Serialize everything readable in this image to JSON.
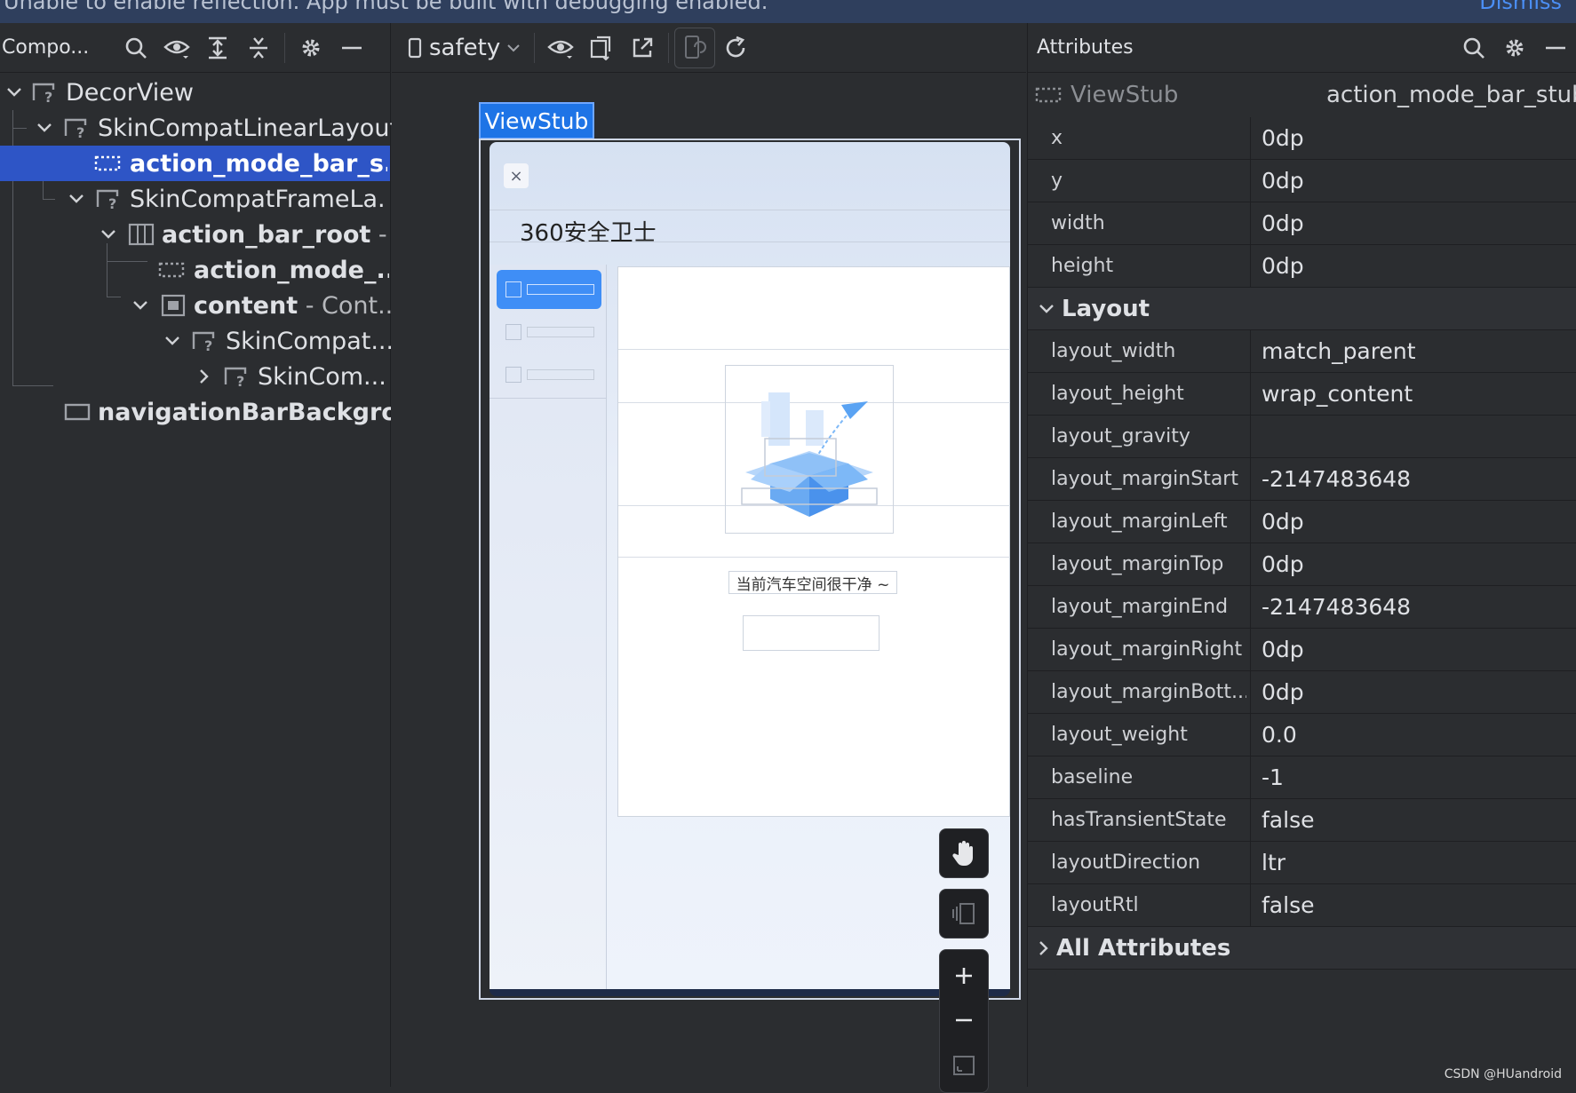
{
  "notice": {
    "message": "Unable to enable reflection. App must be built with debugging enabled.",
    "dismiss": "Dismiss"
  },
  "component_tree": {
    "title": "Compo...",
    "nodes": [
      {
        "label": "DecorView",
        "suffix": ""
      },
      {
        "label": "SkinCompatLinearLayout",
        "suffix": ""
      },
      {
        "label": "action_mode_bar_s...",
        "suffix": ""
      },
      {
        "label": "SkinCompatFrameLa...",
        "suffix": ""
      },
      {
        "label": "action_bar_root",
        "suffix": " -..."
      },
      {
        "label": "action_mode_...",
        "suffix": ""
      },
      {
        "label": "content",
        "suffix": " - Cont..."
      },
      {
        "label": "SkinCompat...",
        "suffix": ""
      },
      {
        "label": "SkinCom...",
        "suffix": ""
      },
      {
        "label": "navigationBarBackgro...",
        "suffix": ""
      }
    ]
  },
  "preview": {
    "device": "safety",
    "selection_label": "ViewStub",
    "app": {
      "close": "×",
      "title": "360安全卫士",
      "sidebar": [
        "",
        "",
        ""
      ],
      "empty_text": "当前汽车空间很干净 ~"
    }
  },
  "attributes": {
    "title": "Attributes",
    "header": {
      "type": "ViewStub",
      "id": "action_mode_bar_stub"
    },
    "rows": [
      {
        "key": "x",
        "value": "0dp"
      },
      {
        "key": "y",
        "value": "0dp"
      },
      {
        "key": "width",
        "value": "0dp"
      },
      {
        "key": "height",
        "value": "0dp"
      }
    ],
    "layout_section": "Layout",
    "layout_rows": [
      {
        "key": "layout_width",
        "value": "match_parent"
      },
      {
        "key": "layout_height",
        "value": "wrap_content"
      },
      {
        "key": "layout_gravity",
        "value": ""
      },
      {
        "key": "layout_marginStart",
        "value": "-2147483648"
      },
      {
        "key": "layout_marginLeft",
        "value": "0dp"
      },
      {
        "key": "layout_marginTop",
        "value": "0dp"
      },
      {
        "key": "layout_marginEnd",
        "value": "-2147483648"
      },
      {
        "key": "layout_marginRight",
        "value": "0dp"
      },
      {
        "key": "layout_marginBott...",
        "value": "0dp"
      },
      {
        "key": "layout_weight",
        "value": "0.0"
      },
      {
        "key": "baseline",
        "value": "-1"
      },
      {
        "key": "hasTransientState",
        "value": "false"
      },
      {
        "key": "layoutDirection",
        "value": "ltr"
      },
      {
        "key": "layoutRtl",
        "value": "false"
      }
    ],
    "all_section": "All Attributes"
  },
  "watermark": "CSDN @HUandroid"
}
